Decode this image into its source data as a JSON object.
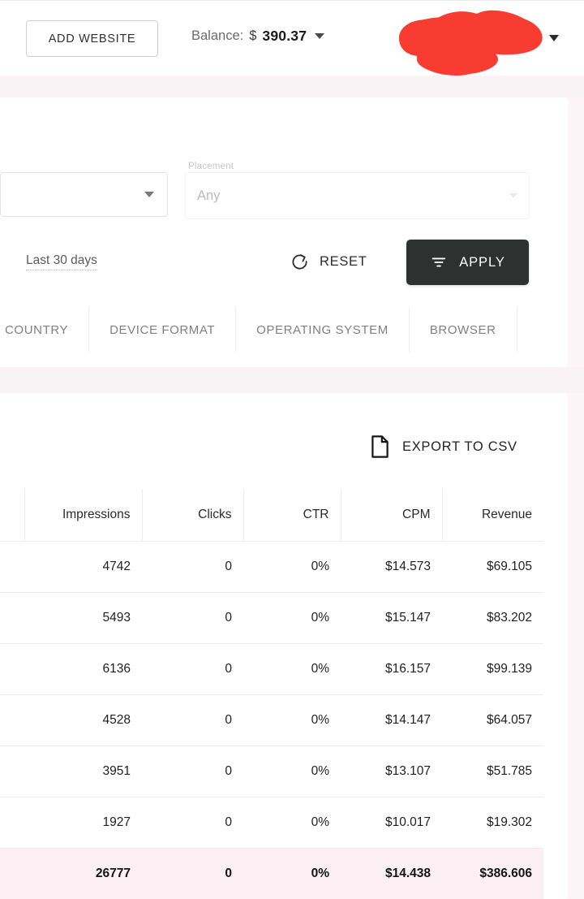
{
  "topbar": {
    "add_website_label": "ADD WEBSITE",
    "balance_label": "Balance:",
    "balance_currency": "$",
    "balance_amount": "390.37",
    "redaction_color": "#f93c32",
    "account_caret_icon": "chevron-down-icon"
  },
  "filters": {
    "website_select_value": "",
    "placement_label": "Placement",
    "placement_value": "Any",
    "date_range": "Last 30 days",
    "reset_label": "RESET",
    "reset_icon": "refresh-icon",
    "apply_label": "APPLY",
    "apply_icon": "filter-icon",
    "apply_bg": "#2f3131",
    "tabs": [
      {
        "label": "COUNTRY"
      },
      {
        "label": "DEVICE FORMAT"
      },
      {
        "label": "OPERATING SYSTEM"
      },
      {
        "label": "BROWSER"
      }
    ]
  },
  "report": {
    "export_label": "EXPORT TO CSV",
    "export_icon": "file-document-icon",
    "table": {
      "headers": [
        "",
        "Impressions",
        "Clicks",
        "CTR",
        "CPM",
        "Revenue"
      ],
      "rows": [
        {
          "label": "",
          "impressions": "4742",
          "clicks": "0",
          "ctr": "0%",
          "cpm": "$14.573",
          "revenue": "$69.105"
        },
        {
          "label": "",
          "impressions": "5493",
          "clicks": "0",
          "ctr": "0%",
          "cpm": "$15.147",
          "revenue": "$83.202"
        },
        {
          "label": "",
          "impressions": "6136",
          "clicks": "0",
          "ctr": "0%",
          "cpm": "$16.157",
          "revenue": "$99.139"
        },
        {
          "label": "",
          "impressions": "4528",
          "clicks": "0",
          "ctr": "0%",
          "cpm": "$14.147",
          "revenue": "$64.057"
        },
        {
          "label": "",
          "impressions": "3951",
          "clicks": "0",
          "ctr": "0%",
          "cpm": "$13.107",
          "revenue": "$51.785"
        },
        {
          "label": "",
          "impressions": "1927",
          "clicks": "0",
          "ctr": "0%",
          "cpm": "$10.017",
          "revenue": "$19.302"
        }
      ],
      "total": {
        "label": "",
        "impressions": "26777",
        "clicks": "0",
        "ctr": "0%",
        "cpm": "$14.438",
        "revenue": "$386.606"
      },
      "total_row_bg": "#fbeff3"
    }
  }
}
